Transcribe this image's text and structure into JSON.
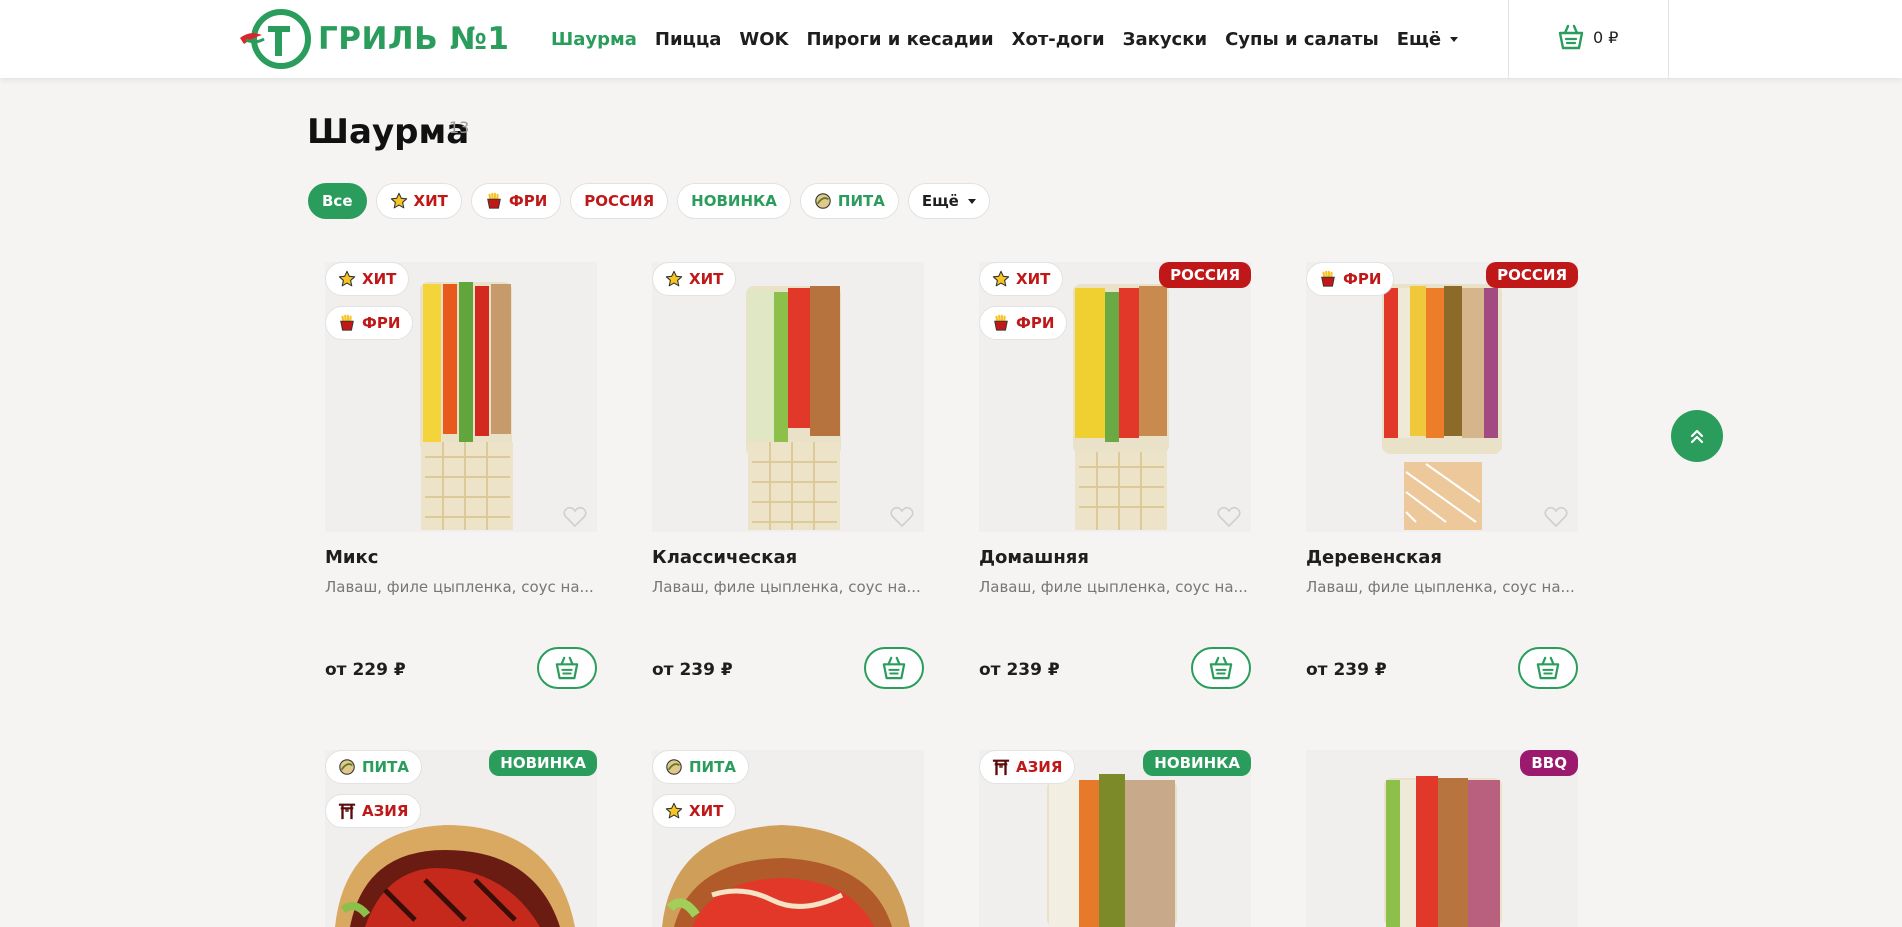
{
  "header": {
    "logo_text": "ГРИЛЬ №1",
    "nav": [
      "Шаурма",
      "Пицца",
      "WOK",
      "Пироги и кесадии",
      "Хот-доги",
      "Закуски",
      "Супы и салаты"
    ],
    "nav_more": "Ещё",
    "cart_total": "0 ₽"
  },
  "page": {
    "title": "Шаурма",
    "count": "13"
  },
  "filters": {
    "all": "Все",
    "hit": "ХИТ",
    "fries": "ФРИ",
    "russia": "РОССИЯ",
    "new": "НОВИНКА",
    "pita": "ПИТА",
    "more": "Ещё"
  },
  "products": [
    {
      "name": "Микс",
      "desc": "Лаваш, филе цыпленка, соус на...",
      "price": "от 229 ₽",
      "tags": [
        "ХИТ",
        "ФРИ"
      ],
      "label": ""
    },
    {
      "name": "Классическая",
      "desc": "Лаваш, филе цыпленка, соус на...",
      "price": "от 239 ₽",
      "tags": [
        "ХИТ"
      ],
      "label": ""
    },
    {
      "name": "Домашняя",
      "desc": "Лаваш, филе цыпленка, соус на...",
      "price": "от 239 ₽",
      "tags": [
        "ХИТ",
        "ФРИ"
      ],
      "label": "РОССИЯ"
    },
    {
      "name": "Деревенская",
      "desc": "Лаваш, филе цыпленка, соус на...",
      "price": "от 239 ₽",
      "tags": [
        "ФРИ"
      ],
      "label": "РОССИЯ"
    },
    {
      "tags": [
        "ПИТА",
        "АЗИЯ"
      ],
      "label": "НОВИНКА"
    },
    {
      "tags": [
        "ПИТА",
        "ХИТ"
      ],
      "label": ""
    },
    {
      "tags": [
        "АЗИЯ"
      ],
      "label": "НОВИНКА"
    },
    {
      "tags": [],
      "label": "BBQ"
    }
  ],
  "colors": {
    "brand_green": "#2a9d5c",
    "tag_red": "#c01818",
    "label_russia": "#c01818",
    "label_new": "#2a9d5c",
    "label_bbq": "#9c1a6e"
  }
}
